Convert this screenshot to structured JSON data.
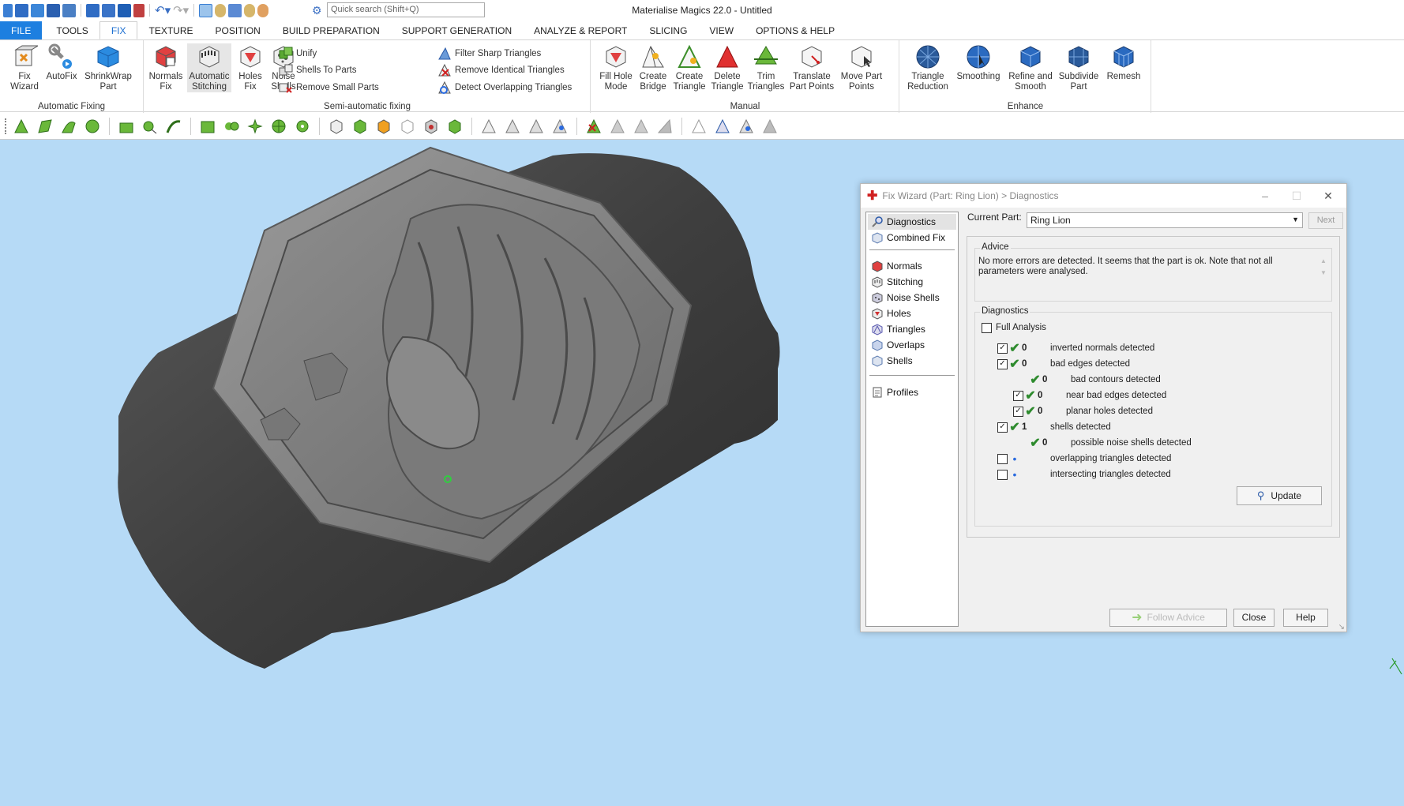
{
  "app_title": "Materialise Magics 22.0 - Untitled",
  "search": {
    "placeholder": "Quick search (Shift+Q)"
  },
  "menu": {
    "tabs": [
      "FILE",
      "TOOLS",
      "FIX",
      "TEXTURE",
      "POSITION",
      "BUILD PREPARATION",
      "SUPPORT GENERATION",
      "ANALYZE & REPORT",
      "SLICING",
      "VIEW",
      "OPTIONS & HELP"
    ],
    "active": "FIX"
  },
  "ribbon": {
    "automatic_fixing": {
      "title": "Automatic Fixing",
      "fix_wizard": "Fix\nWizard",
      "autofix": "AutoFix",
      "shrinkwrap": "ShrinkWrap\nPart"
    },
    "semi_automatic": {
      "title": "Semi-automatic fixing",
      "normals_fix": "Normals\nFix",
      "automatic_stitching": "Automatic\nStitching",
      "holes_fix": "Holes\nFix",
      "noise_shells": "Noise\nShells",
      "unify": "Unify",
      "shells_to_parts": "Shells To Parts",
      "remove_small_parts": "Remove Small Parts",
      "filter_sharp": "Filter Sharp Triangles",
      "remove_identical": "Remove Identical Triangles",
      "detect_overlapping": "Detect Overlapping Triangles"
    },
    "manual": {
      "title": "Manual",
      "fill_hole_mode": "Fill Hole\nMode",
      "create_bridge": "Create\nBridge",
      "create_triangle": "Create\nTriangle",
      "delete_triangle": "Delete\nTriangle",
      "trim_triangles": "Trim\nTriangles",
      "translate_part_points": "Translate\nPart Points",
      "move_part_points": "Move Part\nPoints"
    },
    "enhance": {
      "title": "Enhance",
      "triangle_reduction": "Triangle\nReduction",
      "smoothing": "Smoothing",
      "refine_smooth": "Refine and\nSmooth",
      "subdivide_part": "Subdivide\nPart",
      "remesh": "Remesh"
    }
  },
  "dialog": {
    "title": "Fix Wizard (Part: Ring Lion) > Diagnostics",
    "nav": {
      "diagnostics": "Diagnostics",
      "combined_fix": "Combined Fix",
      "normals": "Normals",
      "stitching": "Stitching",
      "noise_shells": "Noise Shells",
      "holes": "Holes",
      "triangles": "Triangles",
      "overlaps": "Overlaps",
      "shells": "Shells",
      "profiles": "Profiles"
    },
    "current_part_label": "Current Part:",
    "current_part": "Ring Lion",
    "next": "Next",
    "advice_title": "Advice",
    "advice_text": "No more errors are detected. It seems that the part is ok. Note that not all parameters were analysed.",
    "diagnostics_title": "Diagnostics",
    "full_analysis": "Full Analysis",
    "rows": {
      "inverted": {
        "value": "0",
        "label": "inverted normals detected"
      },
      "bad_edges": {
        "value": "0",
        "label": "bad edges detected"
      },
      "bad_contours": {
        "value": "0",
        "label": "bad contours detected"
      },
      "near_bad_edges": {
        "value": "0",
        "label": "near bad edges detected"
      },
      "planar_holes": {
        "value": "0",
        "label": "planar holes detected"
      },
      "shells": {
        "value": "1",
        "label": "shells detected"
      },
      "noise_shells": {
        "value": "0",
        "label": "possible noise shells detected"
      },
      "overlapping": {
        "label": "overlapping triangles detected"
      },
      "intersecting": {
        "label": "intersecting triangles detected"
      }
    },
    "update": "Update",
    "follow_advice": "Follow Advice",
    "close": "Close",
    "help": "Help"
  }
}
